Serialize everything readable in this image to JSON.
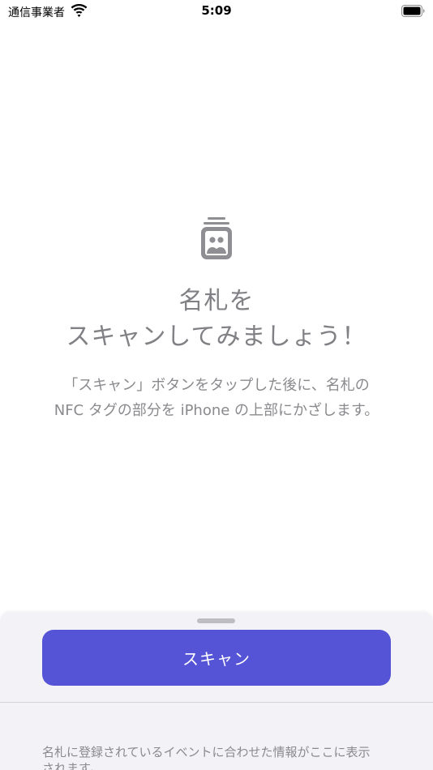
{
  "status_bar": {
    "carrier": "通信事業者",
    "time": "5:09"
  },
  "icons": {
    "wifi": "wifi-icon",
    "battery": "battery-icon",
    "card_stack": "business-card-stack-icon"
  },
  "empty_state": {
    "title_lines": [
      "名札を",
      "スキャンしてみましょう！"
    ],
    "description_lines": [
      "「スキャン」ボタンをタップした後に、名札の",
      "NFC タグの部分を iPhone の上部にかざします。"
    ]
  },
  "sheet": {
    "scan_button_label": "スキャン",
    "info_lines": [
      "名札に登録されているイベントに合わせた情報がここに表示",
      "されます。"
    ]
  },
  "colors": {
    "accent": "#5654d6",
    "sheet_background": "#f2f2f7",
    "secondary_text": "#8a8a8e"
  }
}
